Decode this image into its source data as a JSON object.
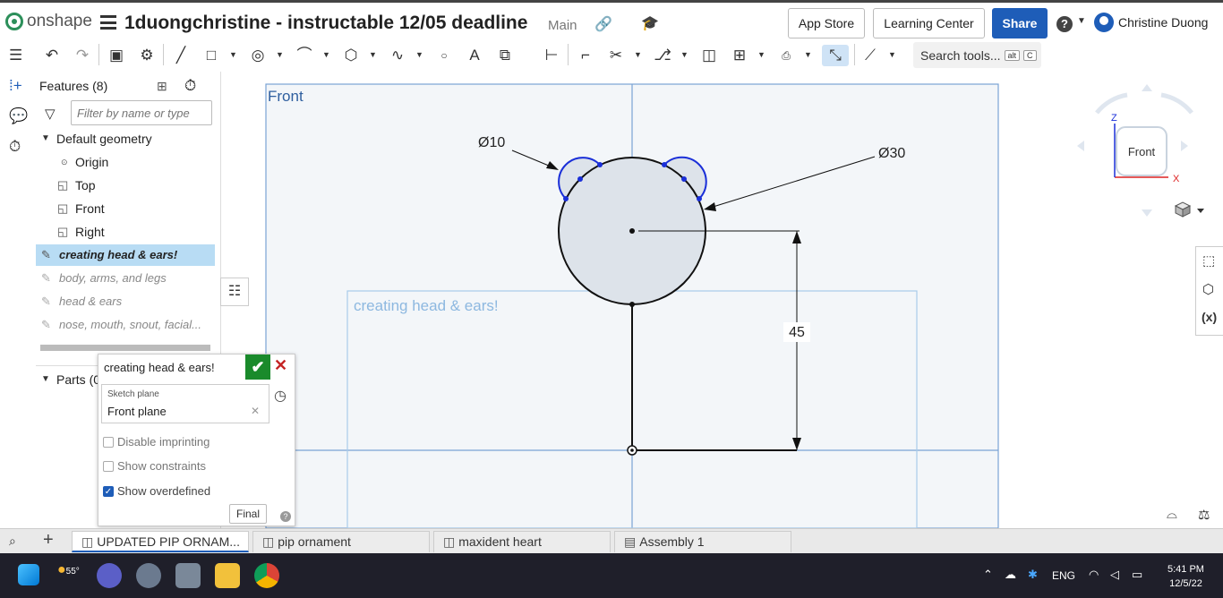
{
  "app": {
    "brand": "onshape",
    "document_title": "1duongchristine - instructable 12/05 deadline",
    "branch": "Main"
  },
  "header": {
    "app_store": "App Store",
    "learning_center": "Learning Center",
    "share": "Share",
    "help": "?",
    "user_name": "Christine Duong"
  },
  "toolbar": {
    "search_label": "Search tools...",
    "search_key1": "alt",
    "search_key2": "C"
  },
  "features": {
    "title": "Features (8)",
    "filter_placeholder": "Filter by name or type",
    "default_geometry": "Default geometry",
    "origin": "Origin",
    "planes": [
      "Top",
      "Front",
      "Right"
    ],
    "items": [
      "creating head & ears!",
      "body, arms, and legs",
      "head & ears",
      "nose, mouth, snout, facial..."
    ],
    "parts": "Parts (0"
  },
  "sketch_dialog": {
    "title": "creating head & ears!",
    "plane_label": "Sketch plane",
    "plane_value": "Front plane",
    "options": [
      {
        "label": "Disable imprinting",
        "checked": false
      },
      {
        "label": "Show constraints",
        "checked": false
      },
      {
        "label": "Show overdefined",
        "checked": true
      }
    ],
    "final_button": "Final",
    "help": "?"
  },
  "viewport": {
    "plane_name": "Front",
    "sketch_label": "creating head & ears!",
    "dim_small": "Ø10",
    "dim_large": "Ø30",
    "dim_vertical": "45",
    "view_cube_label": "Front",
    "axis_z": "Z",
    "axis_x": "X"
  },
  "tabs": [
    "UPDATED PIP ORNAM...",
    "pip ornament",
    "maxident heart",
    "Assembly 1"
  ],
  "taskbar": {
    "weather": "55°",
    "language": "ENG",
    "time": "5:41 PM",
    "date": "12/5/22"
  },
  "colors": {
    "share_blue": "#1e5db8",
    "sketch_blue": "#1a2fd8",
    "plane_blue": "#3a6ab0",
    "confirm_green": "#1a8a2b",
    "cancel_red": "#c42424",
    "selected_row": "#b8dcf4"
  }
}
